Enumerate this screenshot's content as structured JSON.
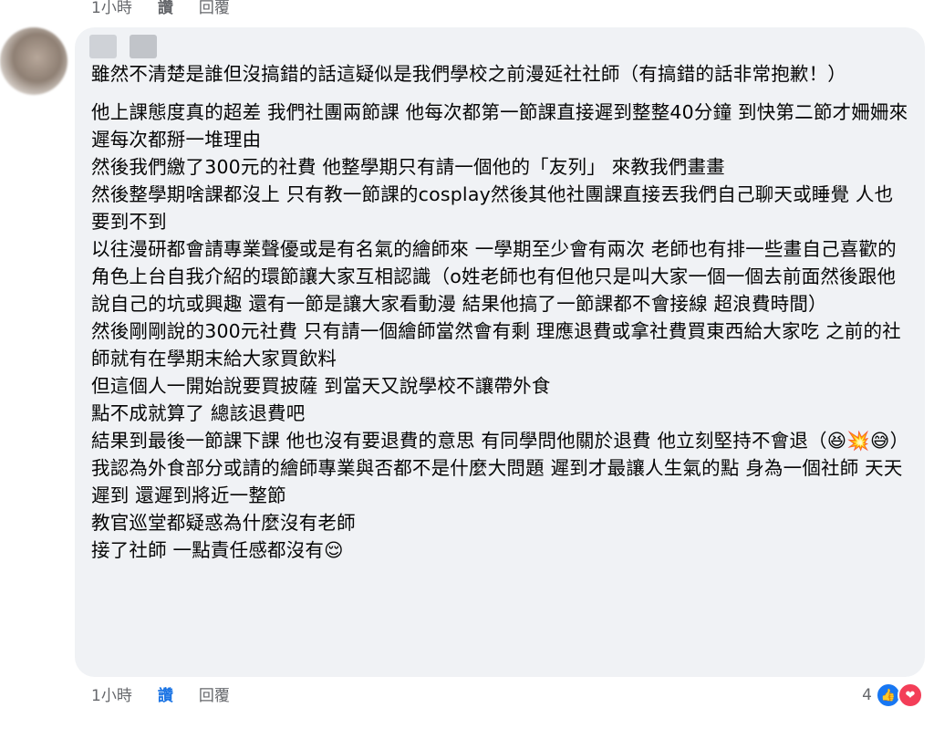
{
  "top_meta": {
    "time": "1小時",
    "like": "讚",
    "reply": "回覆"
  },
  "comment": {
    "lines": [
      "雖然不清楚是誰但沒搞錯的話這疑似是我們學校之前漫延社社師（有搞錯的話非常抱歉！）",
      "",
      "他上課態度真的超差 我們社團兩節課 他每次都第一節課直接遲到整整40分鐘 到快第二節才姍姍來遲每次都掰一堆理由",
      "然後我們繳了300元的社費 他整學期只有請一個他的「友列」 來教我們畫畫",
      "然後整學期啥課都沒上 只有教一節課的cosplay然後其他社團課直接丟我們自己聊天或睡覺 人也要到不到",
      "以往漫研都會請專業聲優或是有名氣的繪師來 一學期至少會有兩次 老師也有排一些畫自己喜歡的角色上台自我介紹的環節讓大家互相認識（o姓老師也有但他只是叫大家一個一個去前面然後跟他說自己的坑或興趣 還有一節是讓大家看動漫 結果他搞了一節課都不會接線 超浪費時間）",
      "然後剛剛說的300元社費 只有請一個繪師當然會有剩 理應退費或拿社費買東西給大家吃 之前的社師就有在學期末給大家買飲料",
      "但這個人一開始說要買披薩 到當天又說學校不讓帶外食",
      "點不成就算了 總該退費吧",
      "結果到最後一節課下課 他也沒有要退費的意思 有同學問他關於退費 他立刻堅持不會退（😆💥😅）",
      "我認為外食部分或請的繪師專業與否都不是什麼大問題 遲到才最讓人生氣的點 身為一個社師 天天遲到 還遲到將近一整節",
      "教官巡堂都疑惑為什麼沒有老師",
      "接了社師 一點責任感都沒有😌"
    ]
  },
  "bottom_meta": {
    "time": "1小時",
    "like": "讚",
    "reply": "回覆"
  },
  "reactions": {
    "count": "4",
    "icons": [
      "like-icon",
      "love-icon"
    ]
  }
}
